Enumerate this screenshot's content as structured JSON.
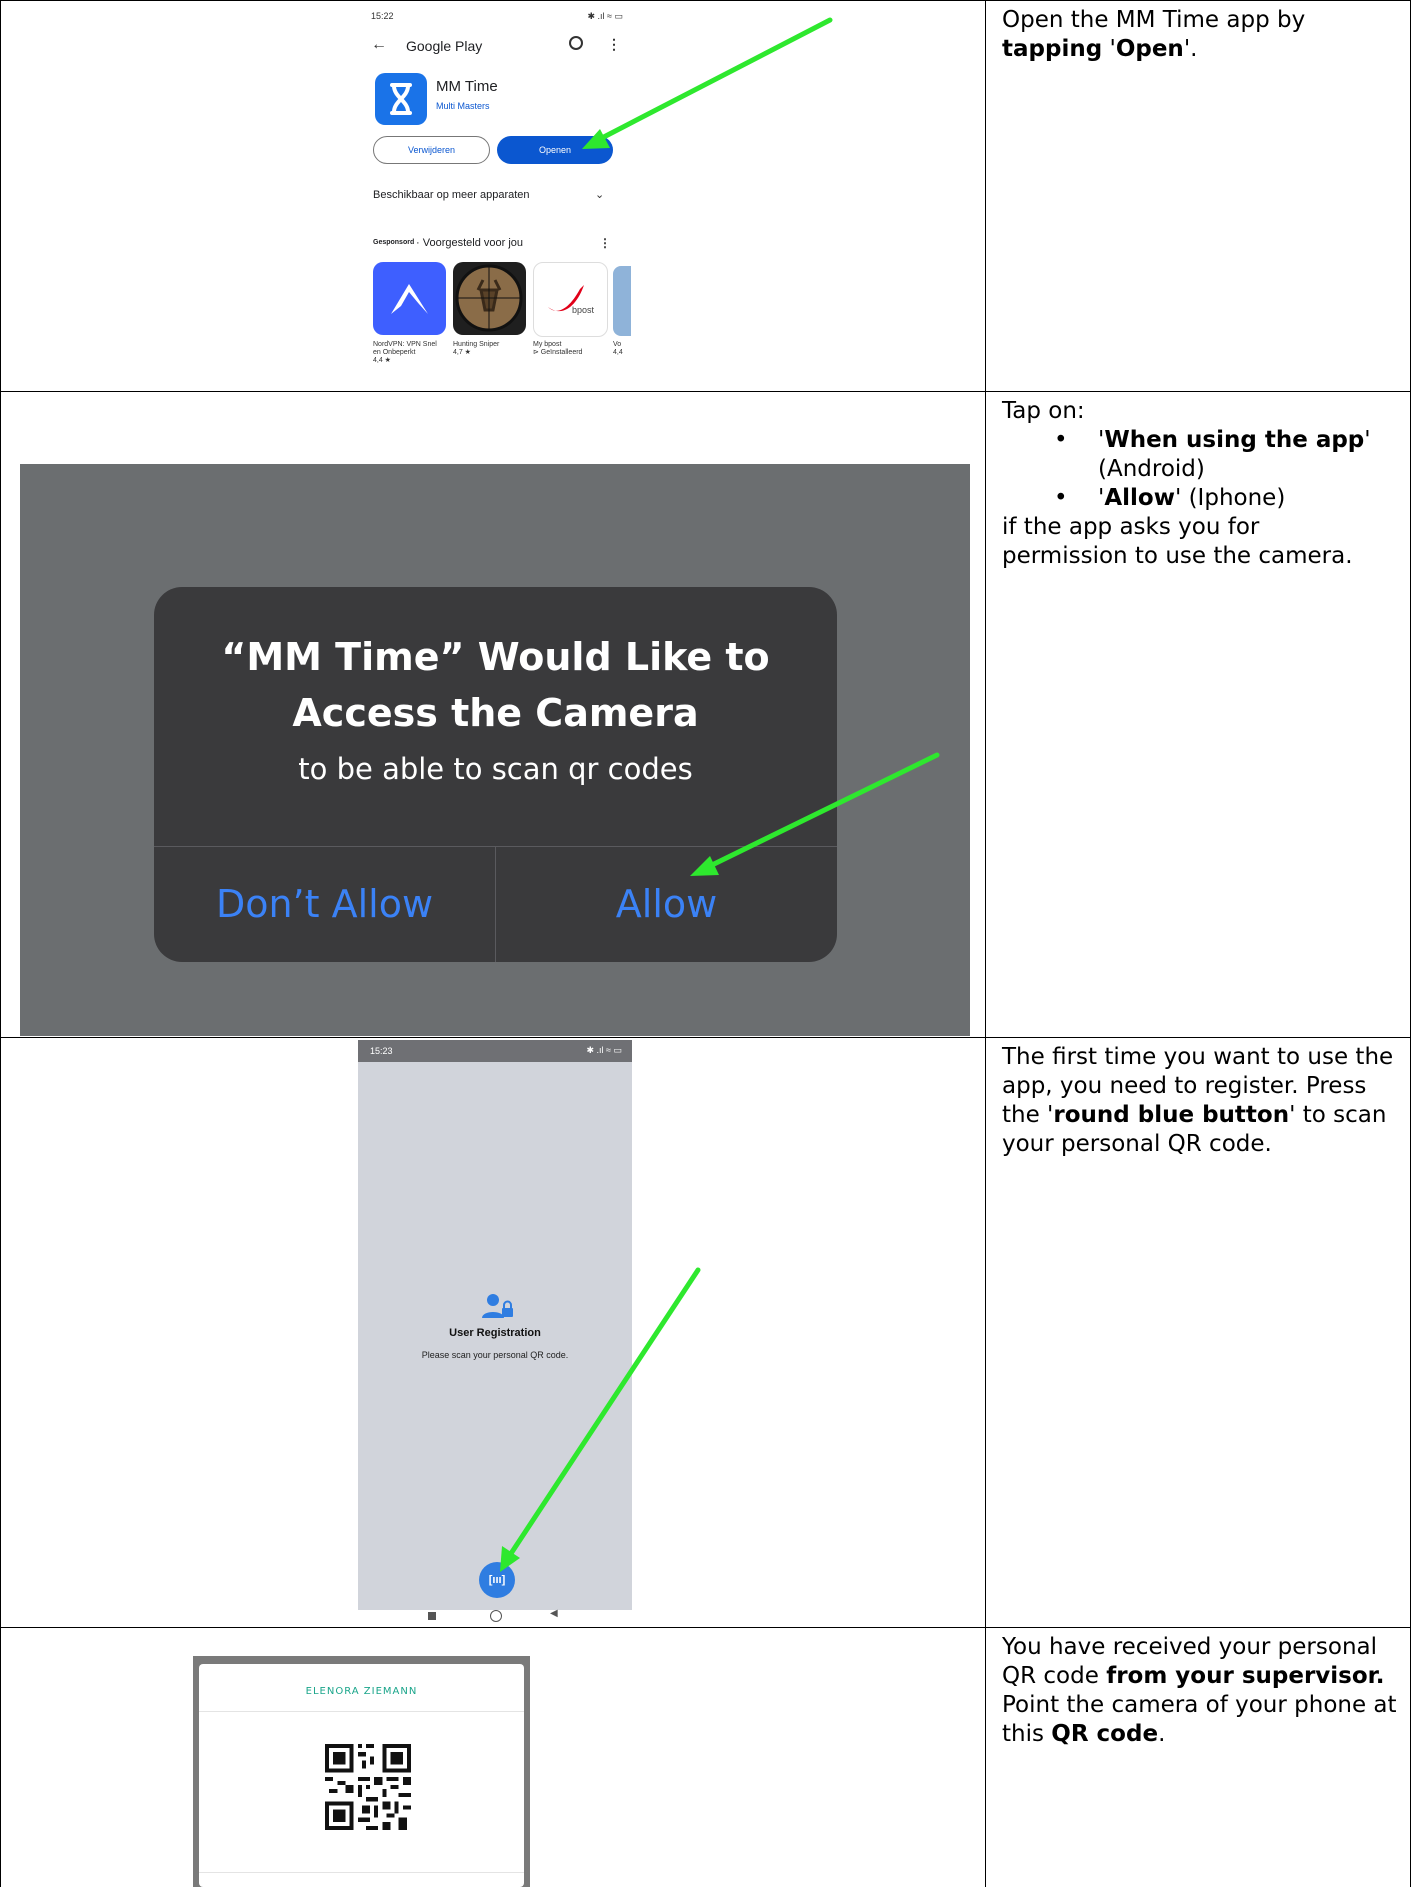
{
  "rows": [
    {
      "instruction": {
        "pre": "Open the MM Time app by ",
        "b1": "tapping",
        "mid": " '",
        "b2": "Open",
        "post": "'."
      },
      "phone": {
        "time": "15:22",
        "store_title": "Google Play",
        "app_name": "MM Time",
        "developer": "Multi Masters",
        "uninstall_label": "Verwijderen",
        "open_label": "Openen",
        "devices_label": "Beschikbaar op meer apparaten",
        "sponsored_label": "Gesponsord",
        "suggested_label": "Voorgesteld voor jou",
        "apps": [
          {
            "name1": "NordVPN: VPN Snel",
            "name2": "en Onbeperkt",
            "meta": "4,4 ★"
          },
          {
            "name1": "Hunting Sniper",
            "name2": "",
            "meta": "4,7 ★"
          },
          {
            "name1": "My bpost",
            "name2": "",
            "meta": "⊳ Geïnstalleerd"
          },
          {
            "name1": "Vo",
            "name2": "",
            "meta": "4,4"
          }
        ],
        "bpost_logo": "bpost"
      }
    },
    {
      "instruction": {
        "intro": "Tap on:",
        "b1_q1": "'",
        "b1_bold": "When using the app",
        "b1_q2": "'",
        "b1_rest": "(Android)",
        "b2_q1": "'",
        "b2_bold": "Allow",
        "b2_rest": "' (Iphone)",
        "outro": "if the app asks you for permission to use the camera."
      },
      "dialog": {
        "title_line1": "“MM Time” Would Like to",
        "title_line2": "Access the Camera",
        "message": "to be able to scan qr codes",
        "deny_label": "Don’t Allow",
        "allow_label": "Allow"
      }
    },
    {
      "instruction": {
        "pre": "The first time you want to use the app, you need to register. Press the '",
        "bold": "round blue button",
        "post": "' to scan your personal QR code."
      },
      "phone": {
        "time": "15:23",
        "title": "User Registration",
        "subtitle": "Please scan your personal QR code."
      }
    },
    {
      "instruction": {
        "pre": "You have received your personal QR code ",
        "bold1": "from your supervisor.",
        "mid": " Point the camera of your phone at this ",
        "bold2": "QR code",
        "post": "."
      },
      "card": {
        "name": "ELENORA ZIEMANN"
      }
    }
  ],
  "colors": {
    "arrow": "#2ee82e",
    "play_blue": "#0b57d0",
    "ios_blue": "#3b82f6",
    "dialog_bg": "#3a3a3c",
    "dim_bg": "#6b6e70",
    "reg_bg": "#d1d4db",
    "fab": "#2f7de1",
    "accent_green": "#1aa58a"
  }
}
